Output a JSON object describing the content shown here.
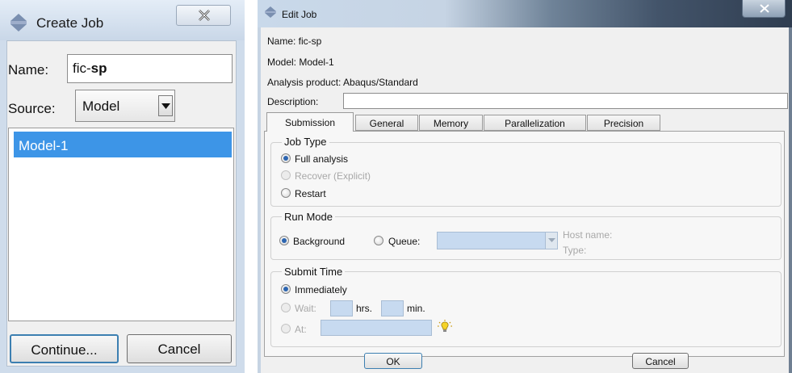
{
  "create_job": {
    "title": "Create Job",
    "name_label": "Name:",
    "name_value_prefix": "fic-",
    "name_value_bold": "sp",
    "source_label": "Source:",
    "source_value": "Model",
    "models": [
      "Model-1"
    ],
    "continue_label": "Continue...",
    "cancel_label": "Cancel"
  },
  "edit_job": {
    "title": "Edit Job",
    "name_line": "Name:  fic-sp",
    "model_line": "Model:  Model-1",
    "product_line": "Analysis product:  Abaqus/Standard",
    "description_label": "Description:",
    "description_value": "",
    "tabs": [
      {
        "label": "Submission",
        "active": true
      },
      {
        "label": "General",
        "active": false
      },
      {
        "label": "Memory",
        "active": false
      },
      {
        "label": "Parallelization",
        "active": false
      },
      {
        "label": "Precision",
        "active": false
      }
    ],
    "job_type": {
      "title": "Job Type",
      "options": [
        {
          "label": "Full analysis",
          "selected": true,
          "enabled": true
        },
        {
          "label": "Recover (Explicit)",
          "selected": false,
          "enabled": false
        },
        {
          "label": "Restart",
          "selected": false,
          "enabled": true
        }
      ]
    },
    "run_mode": {
      "title": "Run Mode",
      "background_label": "Background",
      "queue_label": "Queue:",
      "host_name_label": "Host name:",
      "type_label": "Type:"
    },
    "submit_time": {
      "title": "Submit Time",
      "immediately_label": "Immediately",
      "wait_label": "Wait:",
      "hrs_label": "hrs.",
      "min_label": "min.",
      "at_label": "At:"
    },
    "ok_label": "OK",
    "cancel_label": "Cancel"
  },
  "colors": {
    "selection": "#3d95e7",
    "field_blue": "#c7daf0",
    "title_dark": "#2f3d50"
  }
}
